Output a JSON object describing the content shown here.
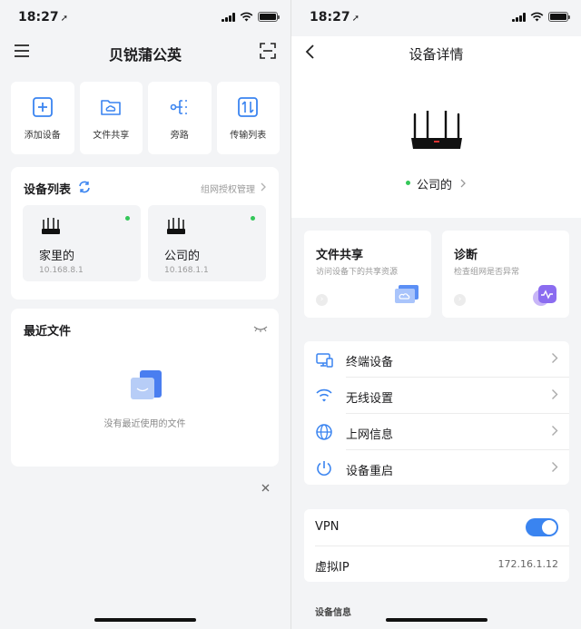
{
  "status": {
    "time": "18:27"
  },
  "left": {
    "title": "贝锐蒲公英",
    "quick": [
      "添加设备",
      "文件共享",
      "旁路",
      "传输列表"
    ],
    "device_list": {
      "title": "设备列表",
      "link": "组网授权管理",
      "devices": [
        {
          "name": "家里的",
          "ip": "10.168.8.1"
        },
        {
          "name": "公司的",
          "ip": "10.168.1.1"
        }
      ]
    },
    "recent": {
      "title": "最近文件",
      "empty": "没有最近使用的文件"
    }
  },
  "right": {
    "title": "设备详情",
    "device_name": "公司的",
    "file_share": {
      "title": "文件共享",
      "desc": "访问设备下的共享资源"
    },
    "diagnose": {
      "title": "诊断",
      "desc": "检查组网是否异常"
    },
    "menu": [
      "终端设备",
      "无线设置",
      "上网信息",
      "设备重启"
    ],
    "vpn": {
      "label": "VPN",
      "enabled": true
    },
    "virtual_ip": {
      "label": "虚拟IP",
      "value": "172.16.1.12"
    },
    "info_title": "设备信息"
  },
  "colors": {
    "accent": "#3a84f0",
    "online": "#34c759",
    "background": "#f3f4f6"
  }
}
